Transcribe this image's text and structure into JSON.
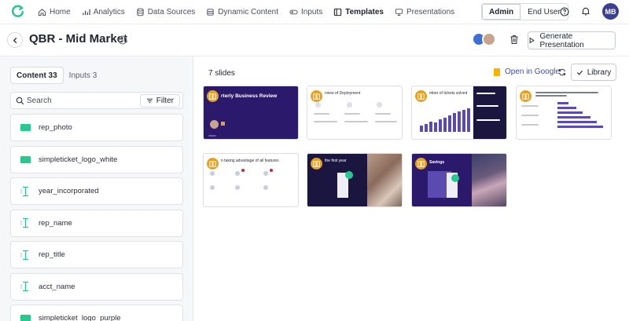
{
  "nav": {
    "items": [
      {
        "label": "Home",
        "icon": "home-icon"
      },
      {
        "label": "Analytics",
        "icon": "chart-icon"
      },
      {
        "label": "Data Sources",
        "icon": "database-icon"
      },
      {
        "label": "Dynamic Content",
        "icon": "layers-icon"
      },
      {
        "label": "Inputs",
        "icon": "toggle-icon"
      },
      {
        "label": "Templates",
        "icon": "template-icon"
      },
      {
        "label": "Presentations",
        "icon": "presentation-icon"
      }
    ],
    "role_admin": "Admin",
    "role_end_user": "End User",
    "avatar_initials": "MB"
  },
  "titlebar": {
    "title": "QBR - Mid Market",
    "generate_label": "Generate Presentation"
  },
  "leftpanel": {
    "tab_content": "Content 33",
    "tab_inputs": "Inputs 3",
    "search_placeholder": "Search",
    "filter_label": "Filter",
    "inputs": [
      {
        "name": "rep_photo",
        "type": "image"
      },
      {
        "name": "simpleticket_logo_white",
        "type": "image"
      },
      {
        "name": "year_incorporated",
        "type": "text"
      },
      {
        "name": "rep_name",
        "type": "text"
      },
      {
        "name": "rep_title",
        "type": "text"
      },
      {
        "name": "acct_name",
        "type": "text"
      },
      {
        "name": "simpleticket_logo_purple",
        "type": "image"
      }
    ]
  },
  "main": {
    "slide_count": "7 slides",
    "open_google": "Open in Google",
    "library_label": "Library",
    "slides": [
      {
        "title": "rterly Business Review"
      },
      {
        "title": "rview of Deployment"
      },
      {
        "title": "mber of tickets solved"
      },
      {
        "title": ""
      },
      {
        "title": "n taking advantage of all features"
      },
      {
        "title": "the first year"
      },
      {
        "title": "Savings"
      }
    ]
  },
  "colors": {
    "brand_purple": "#2b1a6b",
    "badge_orange": "#e8a11c",
    "accent_green": "#27c98f",
    "link_blue": "#3b4fa8"
  }
}
